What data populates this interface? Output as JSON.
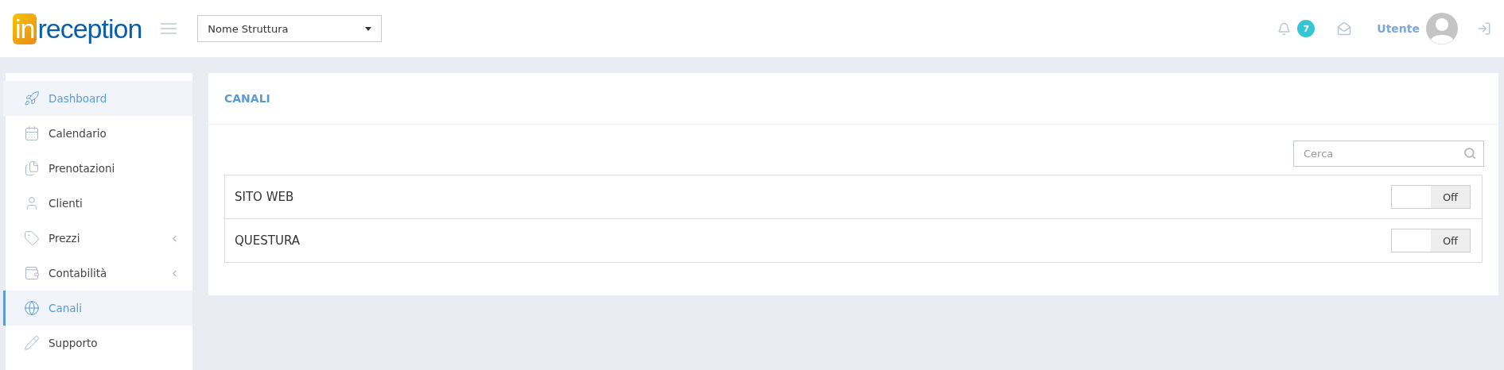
{
  "header": {
    "logo": {
      "prefix": "in",
      "rest": "reception"
    },
    "property_select": {
      "value": "Nome Struttura"
    },
    "notifications": {
      "count": "7"
    },
    "user": {
      "name": "Utente"
    }
  },
  "sidebar": {
    "items": [
      {
        "label": "Dashboard",
        "highlighted": true,
        "selected": false,
        "expandable": false
      },
      {
        "label": "Calendario",
        "highlighted": false,
        "selected": false,
        "expandable": false
      },
      {
        "label": "Prenotazioni",
        "highlighted": false,
        "selected": false,
        "expandable": false
      },
      {
        "label": "Clienti",
        "highlighted": false,
        "selected": false,
        "expandable": false
      },
      {
        "label": "Prezzi",
        "highlighted": false,
        "selected": false,
        "expandable": true
      },
      {
        "label": "Contabilità",
        "highlighted": false,
        "selected": false,
        "expandable": true
      },
      {
        "label": "Canali",
        "highlighted": true,
        "selected": true,
        "expandable": false
      },
      {
        "label": "Supporto",
        "highlighted": false,
        "selected": false,
        "expandable": false
      }
    ]
  },
  "panel": {
    "title": "CANALI",
    "search": {
      "placeholder": "Cerca"
    },
    "channels": [
      {
        "name": "SITO WEB",
        "on": false,
        "toggle_label": "Off"
      },
      {
        "name": "QUESTURA",
        "on": false,
        "toggle_label": "Off"
      }
    ]
  }
}
